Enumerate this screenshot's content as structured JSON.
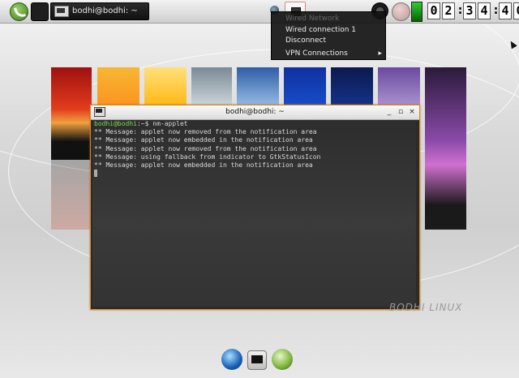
{
  "panel": {
    "task_label": "bodhi@bodhi: ~",
    "clock": [
      "0",
      "2",
      "3",
      "4",
      "4",
      "0"
    ]
  },
  "nm_menu": {
    "header": "Wired Network",
    "items": [
      {
        "label": "Wired connection 1"
      },
      {
        "label": "Disconnect"
      },
      {
        "label": "VPN Connections",
        "arrow": "▸"
      }
    ]
  },
  "terminal": {
    "title": "bodhi@bodhi: ~",
    "buttons": {
      "min": "_",
      "max": "▫",
      "close": "×"
    },
    "prompt_user": "bodhi@bodhi",
    "prompt_rest": ":~$ nm-applet",
    "lines": [
      "** Message: applet now removed from the notification area",
      "** Message: applet now embedded in the notification area",
      "** Message: applet now removed from the notification area",
      "** Message: using fallback from indicator to GtkStatusIcon",
      "** Message: applet now embedded in the notification area"
    ]
  },
  "watermark": "BODHI LINUX",
  "colors": {
    "window_border": "#d7882a",
    "prompt_green": "#7fdc4a"
  }
}
